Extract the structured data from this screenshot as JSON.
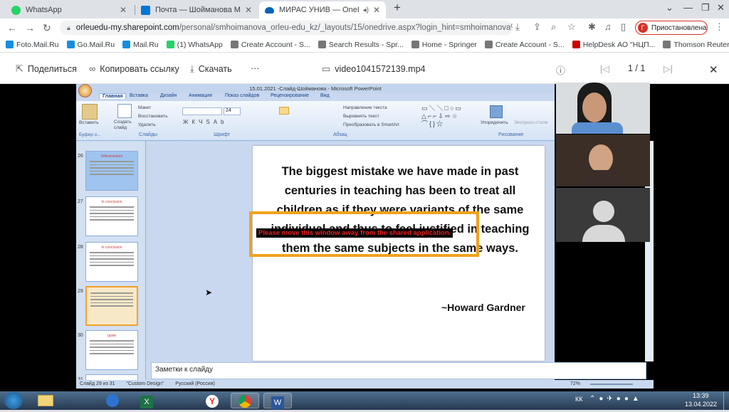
{
  "browser": {
    "tabs": [
      {
        "title": "WhatsApp",
        "color": "#25d366"
      },
      {
        "title": "Почта — Шойманова Молдир Е",
        "color": "#0078d4"
      },
      {
        "title": "МИРАС УНИВ — OneDrive",
        "color": "#0364b8"
      }
    ],
    "new_tab": "+",
    "url_main": "orleuedu-my.sharepoint.com",
    "url_rest": "/personal/smhoimanova_orleu-edu_kz/_layouts/15/onedrive.aspx?login_hint=smhoimanova%40orle...",
    "profile_initial": "Г",
    "profile_label": "Приостановлена",
    "window_controls": [
      "⌄",
      "—",
      "❐",
      "✕"
    ]
  },
  "bookmarks": [
    {
      "label": "Foto.Mail.Ru",
      "color": "#168de2"
    },
    {
      "label": "Go.Mail.Ru",
      "color": "#168de2"
    },
    {
      "label": "Mail.Ru",
      "color": "#168de2"
    },
    {
      "label": "(1) WhatsApp",
      "color": "#25d366"
    },
    {
      "label": "Create Account - S...",
      "color": "#777"
    },
    {
      "label": "Search Results - Spr...",
      "color": "#777"
    },
    {
      "label": "Home - Springer",
      "color": "#777"
    },
    {
      "label": "Create Account - S...",
      "color": "#777"
    },
    {
      "label": "HelpDesk АО \"НЦП...",
      "color": "#c00"
    },
    {
      "label": "Thomson Reuters...",
      "color": "#777"
    }
  ],
  "onedrive": {
    "share": "Поделиться",
    "copy_link": "Копировать ссылку",
    "download": "Скачать",
    "more": "···",
    "filename": "video1041572139.mp4",
    "pager": "1 / 1"
  },
  "ppt": {
    "title": "15.01.2021 -Слайд-Шойманова - Microsoft PowerPoint",
    "tabs": [
      "Главная",
      "Вставка",
      "Дизайн",
      "Анимация",
      "Показ слайдов",
      "Рецензирование",
      "Вид"
    ],
    "ribbon": {
      "paste": "Вставить",
      "clipboard": "Буфер о...",
      "new_slide": "Создать слайд",
      "layout": "Макет",
      "reset": "Восстановить",
      "delete": "Удалить",
      "slides": "Слайды",
      "font": "Шрифт",
      "font_size": "24",
      "text_dir": "Направление текста",
      "align_text": "Выровнять текст",
      "smartart": "Преобразовать в SmartArt",
      "paragraph": "Абзац",
      "arrange": "Упорядочить",
      "quick_styles": "Экспресс-стили",
      "drawing": "Рисование"
    },
    "thumbs": [
      {
        "num": "26",
        "head": "Differentiation"
      },
      {
        "num": "27",
        "head": "In conclusion"
      },
      {
        "num": "28",
        "head": "In conclusion"
      },
      {
        "num": "29",
        "head": ""
      },
      {
        "num": "30",
        "head": "Ідіом"
      },
      {
        "num": "31",
        "head": ""
      }
    ],
    "quote": "The biggest mistake we have made in past centuries in teaching has been to treat all children as if they were variants of the same individual and thus to feel justified in teaching them the same subjects in the same ways.",
    "author": "~Howard Gardner",
    "notes": "Заметки к слайду",
    "status_slide": "Слайд 29 из 31",
    "status_design": "\"Custom Design\"",
    "status_lang": "Русский (Россия)",
    "zoom": "72%"
  },
  "warning": "Please move this window away from the shared application.",
  "taskbar": {
    "apps": [
      "folder",
      "media-player",
      "excel",
      "yandex",
      "chrome",
      "word"
    ],
    "lang": "КК",
    "time": "13:39",
    "date": "13.04.2022"
  }
}
